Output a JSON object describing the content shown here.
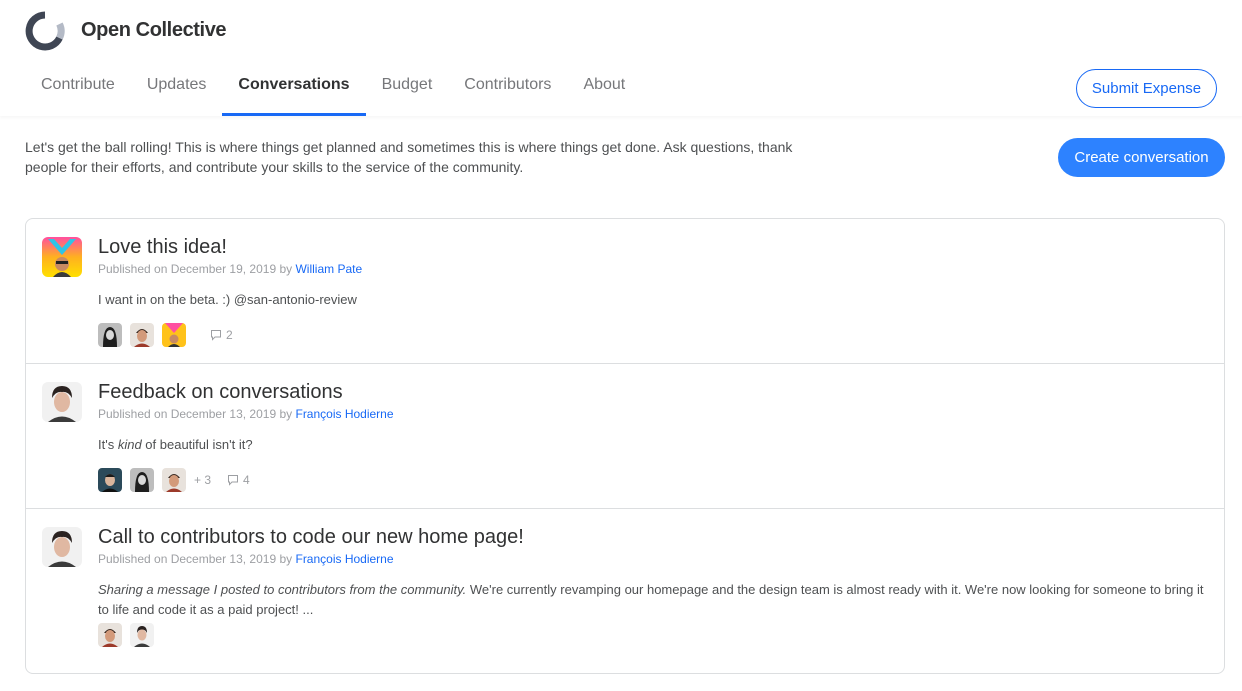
{
  "brand": {
    "name": "Open Collective"
  },
  "nav": {
    "items": [
      {
        "label": "Contribute"
      },
      {
        "label": "Updates"
      },
      {
        "label": "Conversations"
      },
      {
        "label": "Budget"
      },
      {
        "label": "Contributors"
      },
      {
        "label": "About"
      }
    ],
    "submit_label": "Submit Expense"
  },
  "intro": {
    "text": "Let's get the ball rolling! This is where things get planned and sometimes this is where things get done. Ask questions, thank people for their efforts, and contribute your skills to the service of the community.",
    "create_label": "Create conversation"
  },
  "conversations": [
    {
      "title": "Love this idea!",
      "published_prefix": "Published on December 19, 2019 by",
      "author": "William Pate",
      "body_plain": "I want in on the beta. :) @san-antonio-review",
      "more": "",
      "comments": "2"
    },
    {
      "title": "Feedback on conversations",
      "published_prefix": "Published on December 13, 2019 by",
      "author": "François Hodierne",
      "body_pre": "It's ",
      "body_em": "kind",
      "body_post": " of beautiful isn't it?",
      "more": "+ 3",
      "comments": "4"
    },
    {
      "title": "Call to contributors to code our new home page!",
      "published_prefix": "Published on December 13, 2019 by",
      "author": "François Hodierne",
      "body_em": "Sharing a message I posted to contributors from the community.",
      "body_post": " We're currently revamping our homepage and the design team is almost ready with it. We're now looking for someone to bring it to life and code it as a paid project! ..."
    }
  ],
  "colors": {
    "accent": "#1869f5",
    "button": "#2d82ff",
    "text": "#313233",
    "muted": "#9d9fa3",
    "border": "#dcdee0"
  }
}
